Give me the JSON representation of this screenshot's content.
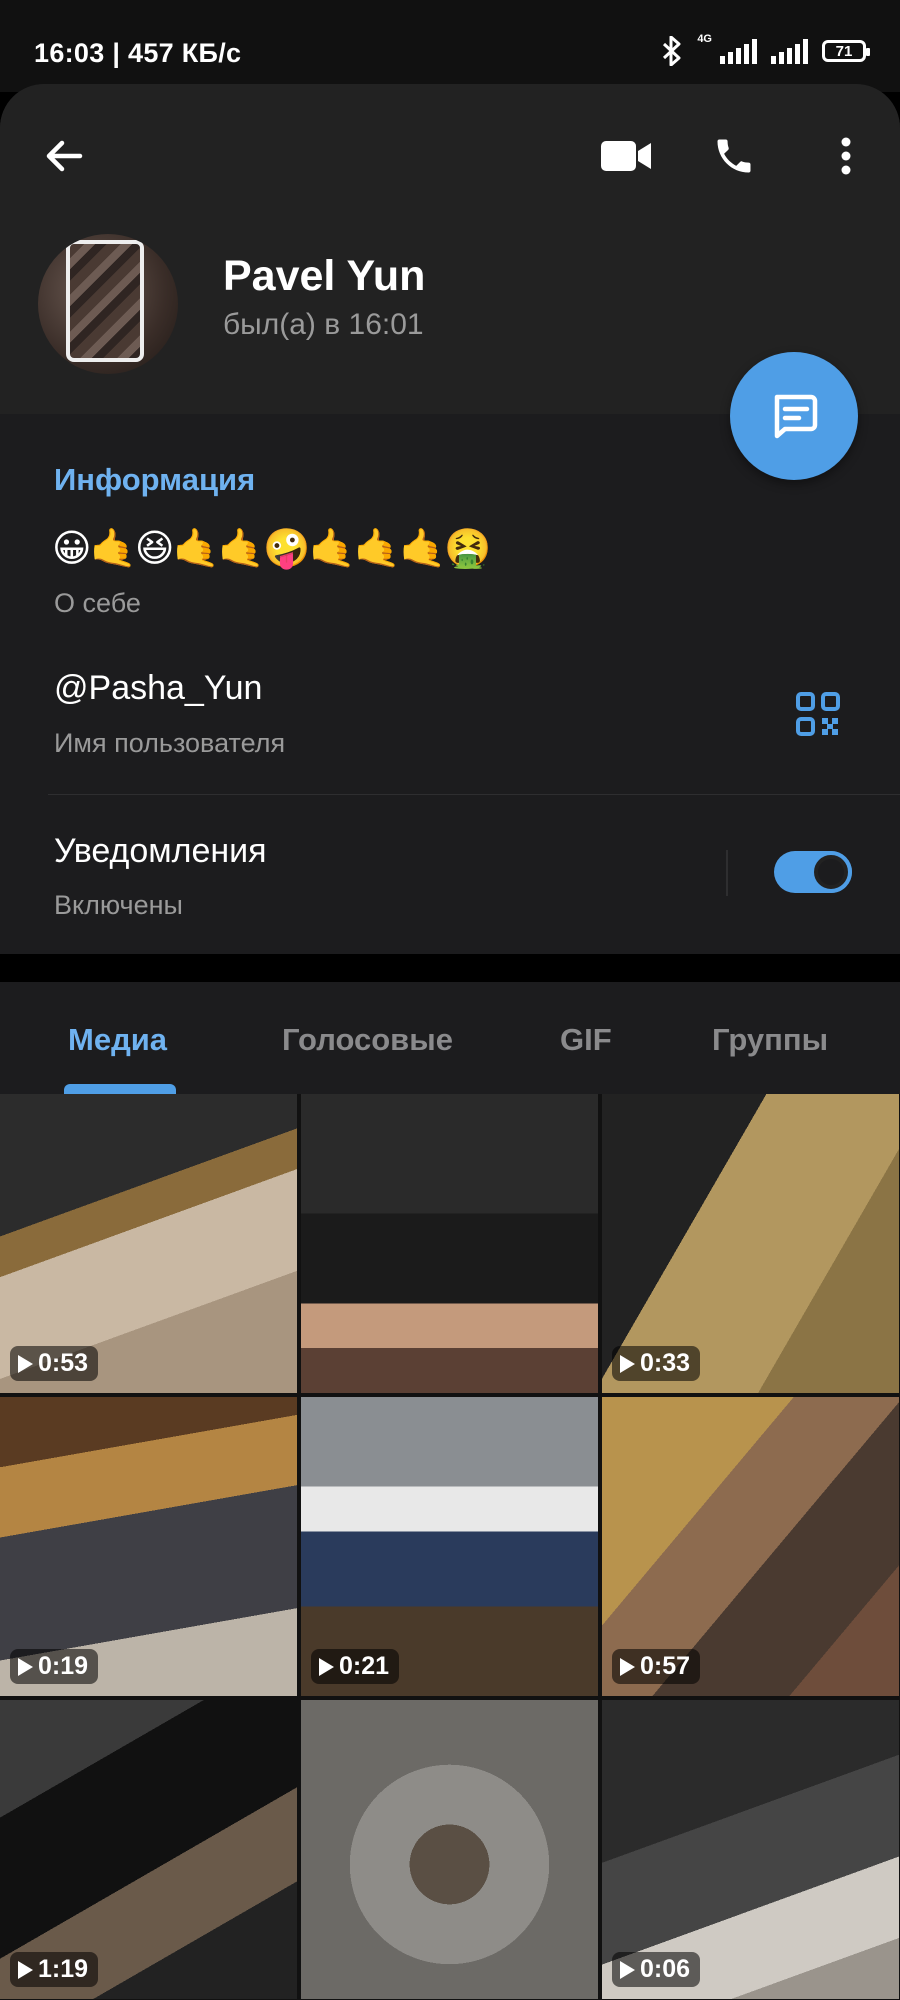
{
  "status_bar": {
    "time_speed": "16:03 | 457 КБ/с",
    "network_type": "4G",
    "battery_level": "71"
  },
  "toolbar": {
    "back_icon": "arrow-left-icon",
    "video_call_icon": "video-camera-icon",
    "call_icon": "phone-icon",
    "menu_icon": "more-vertical-icon"
  },
  "profile": {
    "name": "Pavel Yun",
    "last_seen": "был(а) в 16:01"
  },
  "info": {
    "section_title": "Информация",
    "bio": "😀🤙😆🤙🤙🤪🤙🤙🤙🤮",
    "bio_caption": "О себе",
    "username": "@Pasha_Yun",
    "username_caption": "Имя пользователя",
    "notifications_label": "Уведомления",
    "notifications_status": "Включены",
    "notifications_enabled": true
  },
  "tabs": [
    {
      "label": "Медиа",
      "active": true
    },
    {
      "label": "Голосовые",
      "active": false
    },
    {
      "label": "GIF",
      "active": false
    },
    {
      "label": "Группы",
      "active": false
    }
  ],
  "media": [
    {
      "duration": "0:53"
    },
    {
      "duration": ""
    },
    {
      "duration": "0:33"
    },
    {
      "duration": "0:19"
    },
    {
      "duration": "0:21"
    },
    {
      "duration": "0:57"
    },
    {
      "duration": "1:19"
    },
    {
      "duration": ""
    },
    {
      "duration": "0:06"
    }
  ],
  "colors": {
    "accent": "#4f9ee6",
    "section_title": "#6fb2f0",
    "background": "#1c1c1e",
    "header": "#222222"
  }
}
